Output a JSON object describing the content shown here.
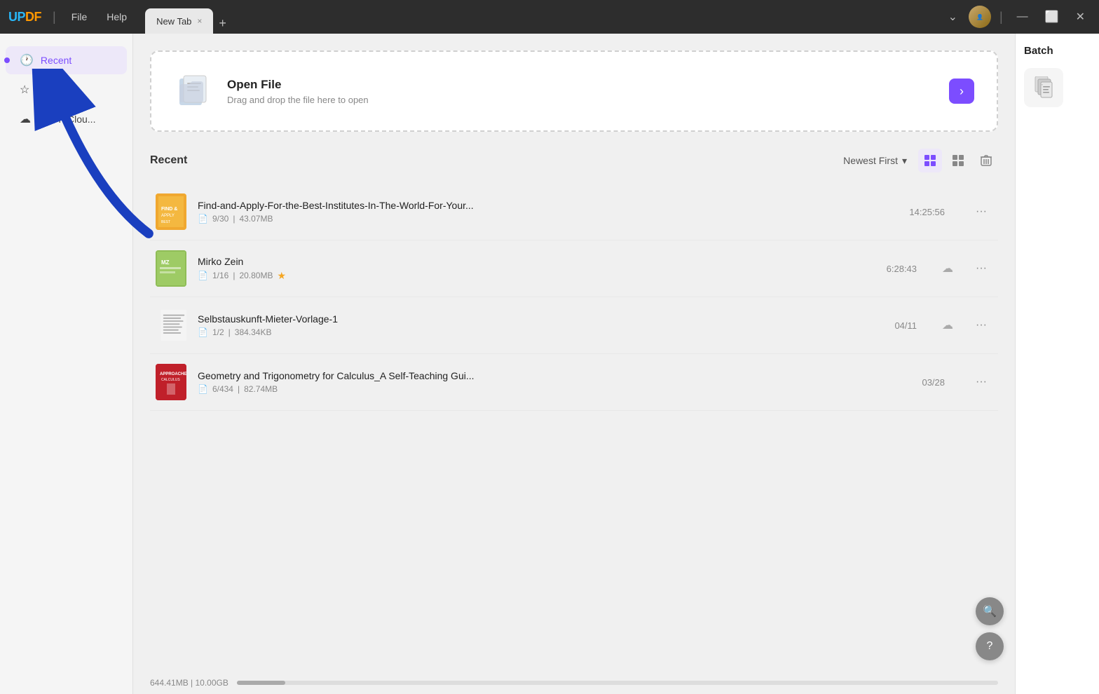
{
  "titlebar": {
    "logo_text": "UPDF",
    "logo_color1": "UP",
    "logo_color2": "DF",
    "sep": "|",
    "menu_file": "File",
    "menu_help": "Help",
    "tab_name": "New Tab",
    "tab_close": "×",
    "tab_add": "+",
    "btn_dropdown": "⌄",
    "btn_minimize": "—",
    "btn_maximize": "⬜",
    "btn_close": "✕"
  },
  "sidebar": {
    "items": [
      {
        "id": "recent",
        "label": "Recent",
        "icon": "🕐",
        "active": true
      },
      {
        "id": "starred",
        "label": "Starred",
        "icon": "☆",
        "active": false
      },
      {
        "id": "cloud",
        "label": "UPDF Clou...",
        "icon": "☁",
        "active": false
      }
    ]
  },
  "open_file": {
    "title": "Open File",
    "subtitle": "Drag and drop the file here to open",
    "arrow": "›"
  },
  "recent": {
    "title": "Recent",
    "sort_label": "Newest First",
    "sort_arrow": "▾",
    "files": [
      {
        "name": "Find-and-Apply-For-the-Best-Institutes-In-The-World-For-Your...",
        "pages": "9/30",
        "size": "43.07MB",
        "date": "14:25:56",
        "starred": false,
        "cloud": false,
        "thumb_type": "1"
      },
      {
        "name": "Mirko Zein",
        "pages": "1/16",
        "size": "20.80MB",
        "date": "6:28:43",
        "starred": true,
        "cloud": true,
        "thumb_type": "2"
      },
      {
        "name": "Selbstauskunft-Mieter-Vorlage-1",
        "pages": "1/2",
        "size": "384.34KB",
        "date": "04/11",
        "starred": false,
        "cloud": true,
        "thumb_type": "3"
      },
      {
        "name": "Geometry and Trigonometry for Calculus_A Self-Teaching Gui...",
        "pages": "6/434",
        "size": "82.74MB",
        "date": "03/28",
        "starred": false,
        "cloud": false,
        "thumb_type": "4"
      }
    ]
  },
  "batch": {
    "title": "Batch",
    "icon": "📄"
  },
  "bottom": {
    "storage": "644.41MB | 10.00GB"
  },
  "float_btns": {
    "search": "🔍",
    "help": "?"
  }
}
